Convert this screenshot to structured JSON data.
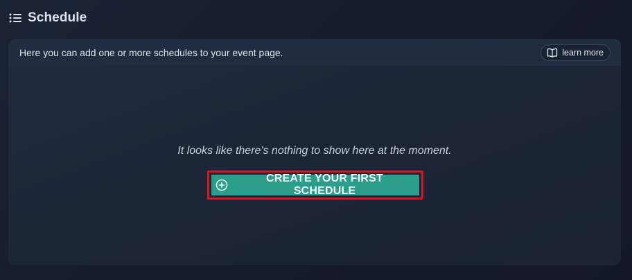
{
  "header": {
    "title": "Schedule",
    "icon": "list-icon"
  },
  "card": {
    "description": "Here you can add one or more schedules to your event page.",
    "learn_more": {
      "label": "learn more",
      "icon": "book-icon"
    },
    "empty_message": "It looks like there's nothing to show here at the moment.",
    "create_button": {
      "label": "CREATE YOUR FIRST SCHEDULE",
      "icon": "plus-circle-icon"
    }
  },
  "colors": {
    "accent": "#2a9d8b",
    "highlight": "#e0141e",
    "background": "#161e2e"
  }
}
